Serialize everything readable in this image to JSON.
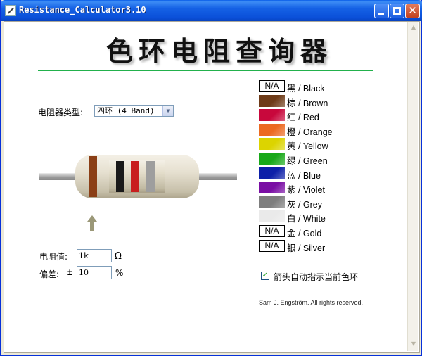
{
  "window": {
    "title": "Resistance_Calculator3.10"
  },
  "header": {
    "title": "色环电阻查询器"
  },
  "type_selector": {
    "label": "电阻器类型:",
    "selected": "四环 (4 Band)"
  },
  "resistor": {
    "bands": [
      {
        "color": "#8b3f16"
      },
      {
        "color": "#1a1a1a"
      },
      {
        "color": "#c81e1e"
      },
      {
        "color": "#9e9e9e"
      }
    ]
  },
  "value": {
    "label": "电阻值:",
    "input": "1k",
    "unit": "Ω"
  },
  "tolerance": {
    "label": "偏差:",
    "pm": "±",
    "input": "10",
    "unit": "%"
  },
  "colors": [
    {
      "swatch": "N/A",
      "color": "#ffffff",
      "name": "黑 / Black"
    },
    {
      "swatch": "",
      "color": "#6e3b18",
      "name": "棕 / Brown"
    },
    {
      "swatch": "",
      "color": "#c8083c",
      "name": "红 / Red"
    },
    {
      "swatch": "",
      "color": "#ec6a22",
      "name": "橙 / Orange"
    },
    {
      "swatch": "",
      "color": "#dcd400",
      "name": "黄 / Yellow"
    },
    {
      "swatch": "",
      "color": "#18a818",
      "name": "绿 / Green"
    },
    {
      "swatch": "",
      "color": "#0d1fa8",
      "name": "蓝 / Blue"
    },
    {
      "swatch": "",
      "color": "#7a0ea4",
      "name": "紫 / Violet"
    },
    {
      "swatch": "",
      "color": "#7e7e7e",
      "name": "灰 / Grey"
    },
    {
      "swatch": "",
      "color": "#eaeaea",
      "name": "白 / White"
    },
    {
      "swatch": "N/A",
      "color": "#ffffff",
      "name": "金 / Gold"
    },
    {
      "swatch": "N/A",
      "color": "#ffffff",
      "name": "银 / Silver"
    }
  ],
  "auto_arrow": {
    "checked": true,
    "label": "箭头自动指示当前色环"
  },
  "credit": "Sam J. Engström. All rights reserved."
}
